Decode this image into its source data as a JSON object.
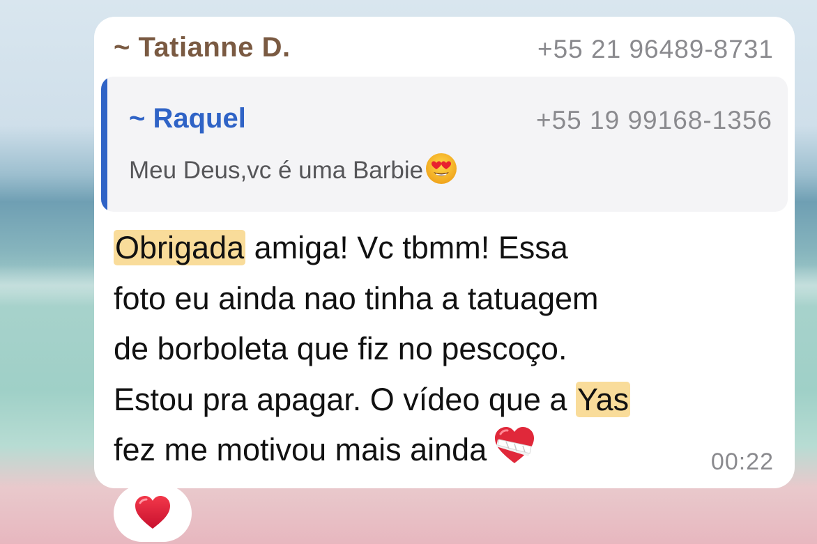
{
  "message": {
    "sender_name": "~ Tatianne D.",
    "sender_phone": "+55 21 96489-8731",
    "reply": {
      "name": "~ Raquel",
      "phone": "+55 19 99168-1356",
      "text": "Meu Deus,vc é uma Barbie",
      "emoji_icon": "heart-eyes-emoji"
    },
    "body": {
      "line1_highlight": "Obrigada",
      "line1_rest": " amiga! Vc tbmm! Essa",
      "line2": "foto eu ainda nao tinha a tatuagem",
      "line3": "de borboleta que fiz no pescoço.",
      "line4_pre": "Estou pra apagar. O vídeo que a ",
      "line4_highlight": "Yas",
      "line5": "fez me motivou mais ainda",
      "end_emoji_icon": "mending-heart-emoji"
    },
    "time": "00:22",
    "reaction_icon": "red-heart-emoji"
  },
  "colors": {
    "sender_name": "#7a5a42",
    "reply_accent": "#2f63c6",
    "highlight": "#f9dc9a",
    "meta_gray": "#8a8a8e"
  }
}
